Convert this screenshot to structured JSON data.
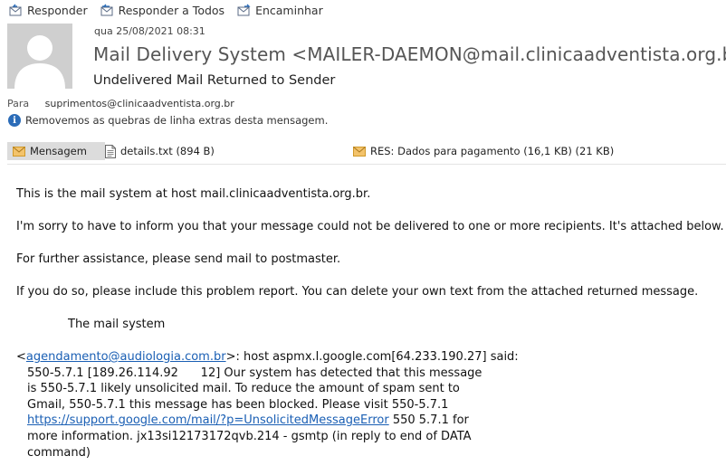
{
  "toolbar": {
    "reply": "Responder",
    "reply_all": "Responder a Todos",
    "forward": "Encaminhar"
  },
  "header": {
    "date": "qua 25/08/2021 08:31",
    "sender": "Mail Delivery System <MAILER-DAEMON@mail.clinicaadventista.org.br>",
    "subject": "Undelivered Mail Returned to Sender",
    "to_label": "Para",
    "to_value": "suprimentos@clinicaadventista.org.br",
    "info": "Removemos as quebras de linha extras desta mensagem."
  },
  "attachments": {
    "message": "Mensagem",
    "details": "details.txt (894 B)",
    "reply_attachment": "RES: Dados para pagamento (16,1 KB) (21 KB)"
  },
  "body": {
    "p1": "This is the mail system at host mail.clinicaadventista.org.br.",
    "p2": "I'm sorry to have to inform you that your message could not be delivered to one or more recipients. It's attached below.",
    "p3": "For further assistance, please send mail to postmaster.",
    "p4": "If you do so, please include this problem report. You can delete your own text from the attached returned message.",
    "signature": "The mail system",
    "bounce_open": "<",
    "bounce_email": "agendamento@audiologia.com.br",
    "bounce_rest": ">: host aspmx.l.google.com[64.233.190.27] said:",
    "line2": "550-5.7.1 [189.26.114.92      12] Our system has detected that this message",
    "line3": "is 550-5.7.1 likely unsolicited mail. To reduce the amount of spam sent to",
    "line4": "Gmail, 550-5.7.1 this message has been blocked. Please visit 550-5.7.1",
    "line5_link": "https://support.google.com/mail/?p=UnsolicitedMessageError",
    "line5_rest": " 550 5.7.1  for",
    "line6": "more information. jx13si12173172qvb.214 - gsmtp (in reply to end of DATA",
    "line7": "command)"
  }
}
